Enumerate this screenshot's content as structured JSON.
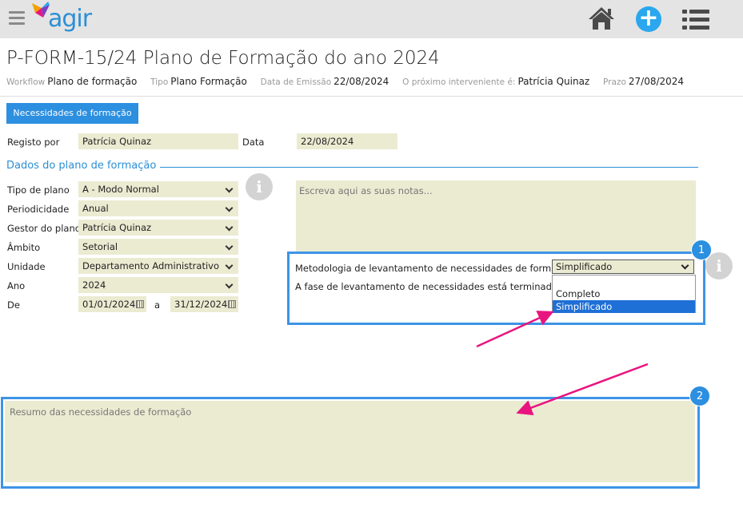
{
  "app": {
    "logo_text": "agir"
  },
  "header": {
    "title": "P-FORM-15/24 Plano de Formação do ano 2024",
    "meta": [
      {
        "key": "Workflow",
        "value": "Plano de formação"
      },
      {
        "key": "Tipo",
        "value": "Plano Formação"
      },
      {
        "key": "Data de Emissão",
        "value": "22/08/2024"
      },
      {
        "key": "O próximo interveniente é:",
        "value": "Patrícia Quinaz"
      },
      {
        "key": "Prazo",
        "value": "27/08/2024"
      }
    ]
  },
  "tab": {
    "label": "Necessidades de formação"
  },
  "record": {
    "registo_label": "Registo por",
    "registo_value": "Patrícia Quinaz",
    "data_label": "Data",
    "data_value": "22/08/2024"
  },
  "section_title": "Dados do plano de formação",
  "form": {
    "tipo_label": "Tipo de plano",
    "tipo_value": "A - Modo Normal",
    "periodicidade_label": "Periodicidade",
    "periodicidade_value": "Anual",
    "gestor_label": "Gestor do plano",
    "gestor_value": "Patrícia Quinaz",
    "ambito_label": "Âmbito",
    "ambito_value": "Setorial",
    "unidade_label": "Unidade",
    "unidade_value": "Departamento Administrativo",
    "ano_label": "Ano",
    "ano_value": "2024",
    "de_label": "De",
    "de_value": "01/01/2024",
    "a_label": "a",
    "ate_value": "31/12/2024"
  },
  "notes": {
    "placeholder": "Escreva aqui as suas notas..."
  },
  "methodology": {
    "label": "Metodologia de levantamento de necessidades de formação",
    "selected": "Simplificado",
    "options": [
      "Completo",
      "Simplificado"
    ],
    "question": "A fase de levantamento de necessidades está terminada?"
  },
  "summary": {
    "placeholder": "Resumo das necessidades de formação"
  },
  "annotations": {
    "badge1": "1",
    "badge2": "2"
  },
  "colors": {
    "accent": "#2c8fe0",
    "field_bg": "#ebebd2",
    "arrow": "#e8157f",
    "highlight": "#3d94e6"
  }
}
